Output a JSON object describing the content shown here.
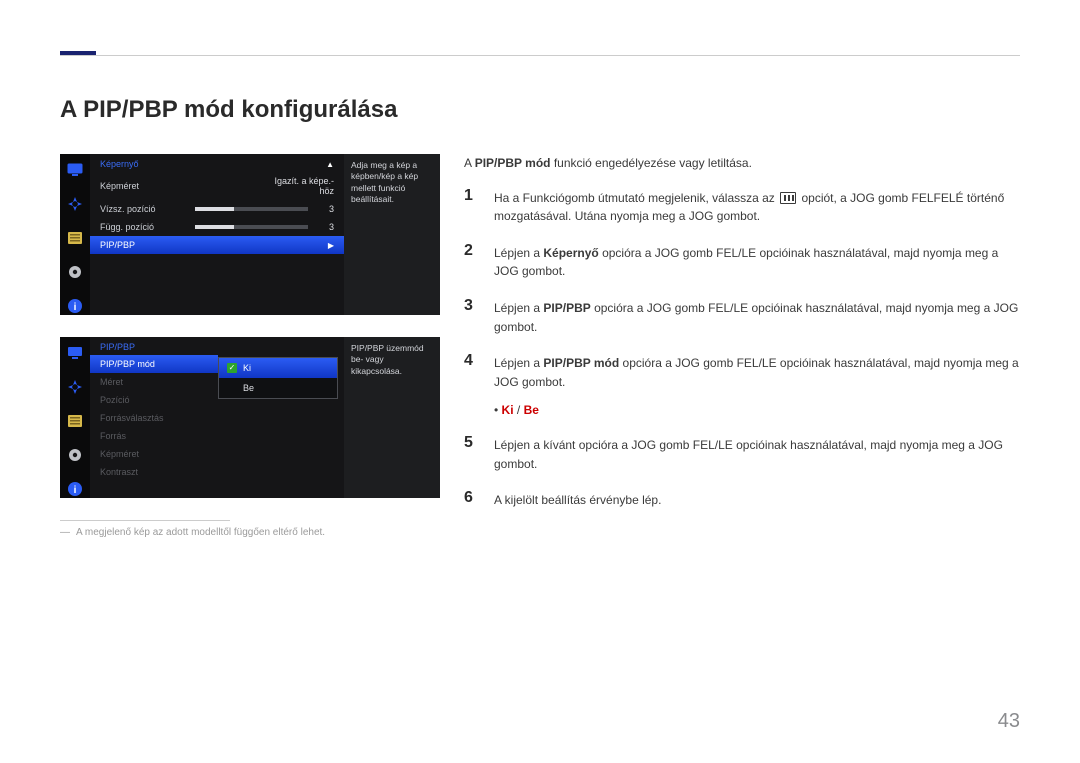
{
  "page_number": "43",
  "title": "A PIP/PBP mód konfigurálása",
  "intro_pre": "A ",
  "intro_bold": "PIP/PBP mód",
  "intro_post": " funkció engedélyezése vagy letiltása.",
  "osd1": {
    "header": "Képernyő",
    "help": "Adja meg a kép a képben/kép a kép mellett funkció beállításait.",
    "rows": [
      {
        "label": "Képméret",
        "val": "Igazít. a képe.-höz"
      },
      {
        "label": "Vízsz. pozíció",
        "val": "3"
      },
      {
        "label": "Függ. pozíció",
        "val": "3"
      }
    ],
    "selected": "PIP/PBP"
  },
  "osd2": {
    "header": "PIP/PBP",
    "help": "PIP/PBP üzemmód be- vagy kikapcsolása.",
    "rows": [
      "PIP/PBP mód",
      "Méret",
      "Pozíció",
      "Forrásválasztás",
      "Forrás",
      "Képméret",
      "Kontraszt"
    ],
    "options": [
      "Ki",
      "Be"
    ]
  },
  "steps": {
    "s1_pre": "Ha a Funkciógomb útmutató megjelenik, válassza az ",
    "s1_post": " opciót, a JOG gomb FELFELÉ történő mozgatásával. Utána nyomja meg a JOG gombot.",
    "s2_pre": "Lépjen a ",
    "s2_bold": "Képernyő",
    "s2_post": " opcióra a JOG gomb FEL/LE opcióinak használatával, majd nyomja meg a JOG gombot.",
    "s3_pre": "Lépjen a ",
    "s3_bold": "PIP/PBP",
    "s3_post": " opcióra a JOG gomb FEL/LE opcióinak használatával, majd nyomja meg a JOG gombot.",
    "s4_pre": "Lépjen a ",
    "s4_bold": "PIP/PBP mód",
    "s4_post": " opcióra a JOG gomb FEL/LE opcióinak használatával, majd nyomja meg a JOG gombot.",
    "s5": "Lépjen a kívánt opcióra a JOG gomb FEL/LE opcióinak használatával, majd nyomja meg a JOG gombot.",
    "s6": "A kijelölt beállítás érvénybe lép."
  },
  "bullet": {
    "ki": "Ki",
    "be": "Be",
    "sep": " / "
  },
  "footnote": "A megjelenő kép az adott modelltől függően eltérő lehet."
}
